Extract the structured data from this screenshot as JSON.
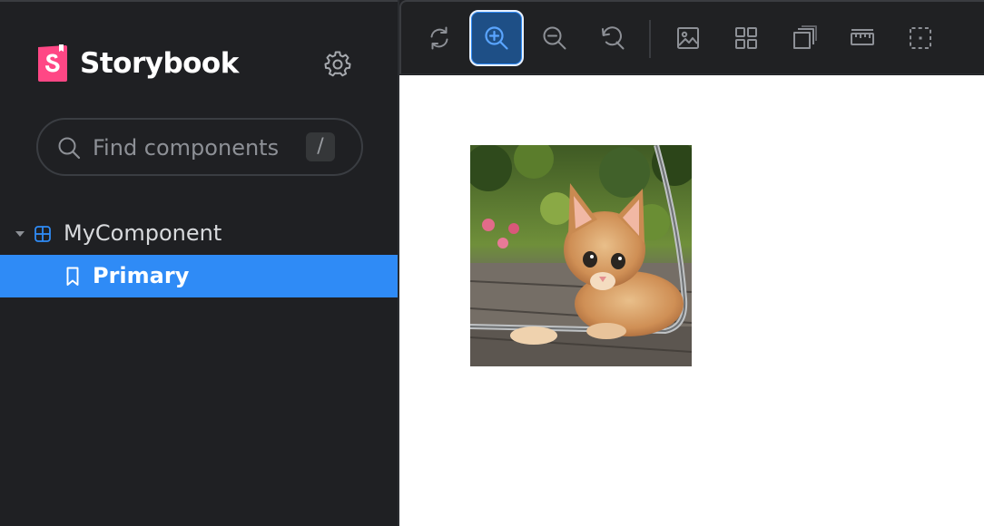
{
  "sidebar": {
    "brand": "Storybook",
    "search": {
      "placeholder": "Find components",
      "shortcut": "/"
    },
    "tree": {
      "component": {
        "label": "MyComponent",
        "icon": "component-grid-icon",
        "expanded": true
      },
      "story": {
        "label": "Primary",
        "icon": "bookmark-icon",
        "selected": true
      }
    }
  },
  "toolbar": {
    "buttons": [
      {
        "name": "reload-icon"
      },
      {
        "name": "zoom-in-icon",
        "active": true
      },
      {
        "name": "zoom-out-icon"
      },
      {
        "name": "zoom-reset-icon"
      },
      {
        "name": "background-image-icon"
      },
      {
        "name": "grid-icon"
      },
      {
        "name": "viewport-outline-icon"
      },
      {
        "name": "ruler-icon"
      },
      {
        "name": "outline-selection-icon"
      }
    ]
  },
  "colors": {
    "accent": "#2f8bf6",
    "sidebar_bg": "#1f2023",
    "brand_pink": "#ff4785",
    "canvas_bg": "#ffffff"
  },
  "preview": {
    "image": "kitten-photo"
  }
}
